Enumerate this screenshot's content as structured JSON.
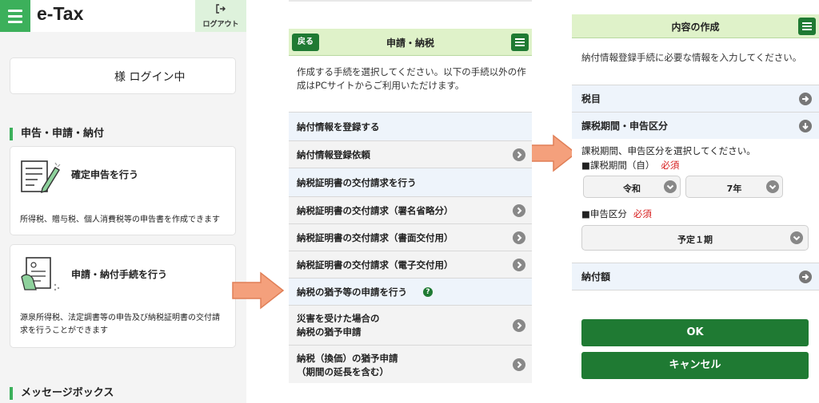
{
  "panel1": {
    "brand": "e-Tax",
    "logout_icon": "logout-icon",
    "logout_label": "ログアウト",
    "login_status": "様 ログイン中",
    "section_title": "申告・申請・納付",
    "card1": {
      "title": "確定申告を行う",
      "desc": "所得税、贈与税、個人消費税等の申告書を作成できます",
      "icon": "document-pen-icon"
    },
    "card2": {
      "title": "申請・納付手続を行う",
      "desc": "源泉所得税、法定調書等の申告及び納税証明書の交付請求を行うことができます",
      "icon": "hand-document-icon"
    },
    "section2_title": "メッセージボックス"
  },
  "panel2": {
    "back_label": "戻る",
    "title": "申請・納税",
    "intro": "作成する手続を選択してください。以下の手続以外の作成はPCサイトからご利用いただけます。",
    "rows": [
      {
        "label": "納付情報を登録する",
        "kind": "head"
      },
      {
        "label": "納付情報登録依頼",
        "kind": "item"
      },
      {
        "label": "納税証明書の交付請求を行う",
        "kind": "head"
      },
      {
        "label": "納税証明書の交付請求（署名省略分）",
        "kind": "item"
      },
      {
        "label": "納税証明書の交付請求（書面交付用）",
        "kind": "item"
      },
      {
        "label": "納税証明書の交付請求（電子交付用）",
        "kind": "item"
      },
      {
        "label": "納税の猶予等の申請を行う",
        "kind": "head"
      },
      {
        "label": "災害を受けた場合の",
        "label2": "納税の猶予申請",
        "kind": "item"
      },
      {
        "label": "納税（換価）の猶予申請",
        "label2": "（期間の延長を含む）",
        "kind": "item"
      }
    ],
    "help_mark": "?"
  },
  "panel3": {
    "title": "内容の作成",
    "intro": "納付情報登録手続に必要な情報を入力してください。",
    "row_tax_item": "税目",
    "row_period": "課税期間・申告区分",
    "period_hint": "課税期間、申告区分を選択してください。",
    "period_label": "■課税期間（自）",
    "required": "必須",
    "era_value": "令和",
    "year_value": "7年",
    "kubun_label": "■申告区分",
    "kubun_value": "予定１期",
    "row_amount": "納付額",
    "ok_label": "OK",
    "cancel_label": "キャンセル"
  },
  "colors": {
    "accent": "#1f7a33",
    "green_light": "#dff2c9",
    "arrow": "#f4a07c",
    "required": "#d61b1b"
  }
}
